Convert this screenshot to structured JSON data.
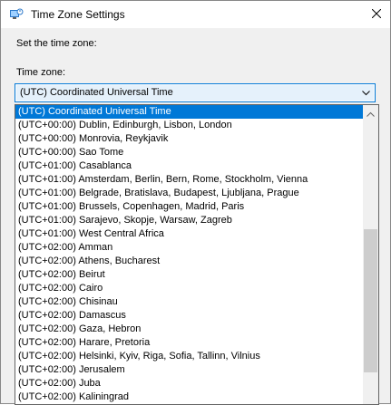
{
  "window": {
    "title": "Time Zone Settings",
    "icon": "time-zone-settings-icon",
    "close": "close-icon"
  },
  "dialog": {
    "set_label": "Set the time zone:",
    "tz_label": "Time zone:"
  },
  "combo": {
    "value": "(UTC) Coordinated Universal Time",
    "arrow": "chevron-down-icon"
  },
  "dropdown": {
    "selected_index": 0,
    "items": [
      "(UTC) Coordinated Universal Time",
      "(UTC+00:00) Dublin, Edinburgh, Lisbon, London",
      "(UTC+00:00) Monrovia, Reykjavik",
      "(UTC+00:00) Sao Tome",
      "(UTC+01:00) Casablanca",
      "(UTC+01:00) Amsterdam, Berlin, Bern, Rome, Stockholm, Vienna",
      "(UTC+01:00) Belgrade, Bratislava, Budapest, Ljubljana, Prague",
      "(UTC+01:00) Brussels, Copenhagen, Madrid, Paris",
      "(UTC+01:00) Sarajevo, Skopje, Warsaw, Zagreb",
      "(UTC+01:00) West Central Africa",
      "(UTC+02:00) Amman",
      "(UTC+02:00) Athens, Bucharest",
      "(UTC+02:00) Beirut",
      "(UTC+02:00) Cairo",
      "(UTC+02:00) Chisinau",
      "(UTC+02:00) Damascus",
      "(UTC+02:00) Gaza, Hebron",
      "(UTC+02:00) Harare, Pretoria",
      "(UTC+02:00) Helsinki, Kyiv, Riga, Sofia, Tallinn, Vilnius",
      "(UTC+02:00) Jerusalem",
      "(UTC+02:00) Juba",
      "(UTC+02:00) Kaliningrad"
    ]
  },
  "colors": {
    "accent": "#0078d7",
    "scroll_thumb": "#cdcdcd",
    "client_background": "#f0f0f0"
  }
}
